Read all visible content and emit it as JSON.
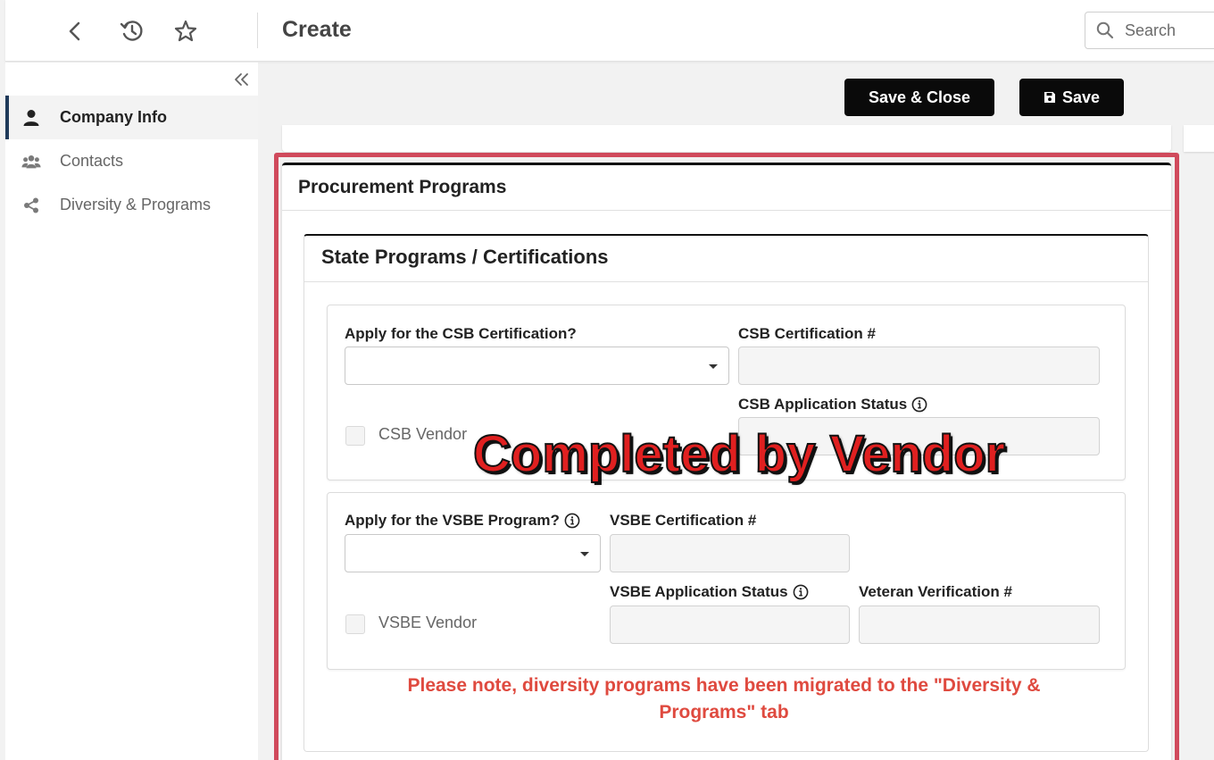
{
  "topbar": {
    "title": "Create",
    "search_placeholder": "Search",
    "icons": [
      "back-icon",
      "history-icon",
      "star-icon",
      "search-icon"
    ]
  },
  "sidebar": {
    "collapse_icon": "double-chevron-left-icon",
    "items": [
      {
        "label": "Company Info",
        "icon": "person-icon",
        "active": true
      },
      {
        "label": "Contacts",
        "icon": "people-icon",
        "active": false
      },
      {
        "label": "Diversity & Programs",
        "icon": "share-icon",
        "active": false
      }
    ]
  },
  "toolbar": {
    "save_close_label": "Save & Close",
    "save_label": "Save",
    "save_icon": "floppy-disk-icon"
  },
  "procurement": {
    "title": "Procurement Programs",
    "state_section": {
      "title": "State Programs / Certifications",
      "csb": {
        "apply_label": "Apply for the CSB Certification?",
        "apply_value": "",
        "cert_label": "CSB Certification #",
        "cert_value": "",
        "status_label": "CSB Application Status",
        "status_value": "",
        "vendor_checkbox_label": "CSB Vendor",
        "vendor_checked": false
      },
      "vsbe": {
        "apply_label": "Apply for the VSBE Program?",
        "apply_value": "",
        "cert_label": "VSBE Certification #",
        "cert_value": "",
        "status_label": "VSBE Application Status",
        "status_value": "",
        "veteran_label": "Veteran Verification #",
        "veteran_value": "",
        "vendor_checkbox_label": "VSBE Vendor",
        "vendor_checked": false
      },
      "note": "Please note, diversity programs have been migrated to the \"Diversity & Programs\" tab"
    }
  },
  "overlay": {
    "text": "Completed by Vendor",
    "color": "#e02020",
    "frame_color": "#d04a5c"
  }
}
